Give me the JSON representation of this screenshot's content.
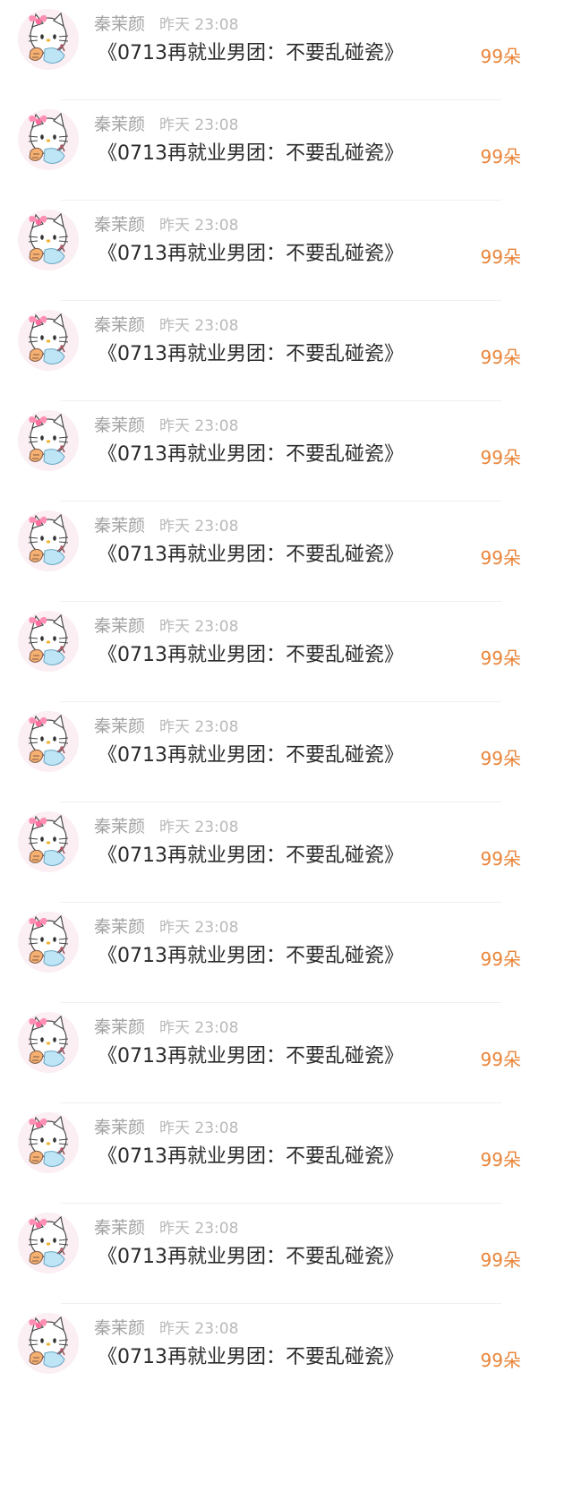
{
  "colors": {
    "name": "#a3a3a3",
    "time": "#b9b9b9",
    "message": "#2b2b2b",
    "count": "#ea8438",
    "avatar_bg": "#fbeff4"
  },
  "rows": [
    {
      "name": "秦茉颜",
      "time": "昨天 23:08",
      "message": "《0713再就业男团：不要乱碰瓷》",
      "count": "99朵",
      "avatar_icon": "hello-kitty-avatar-icon"
    },
    {
      "name": "秦茉颜",
      "time": "昨天 23:08",
      "message": "《0713再就业男团：不要乱碰瓷》",
      "count": "99朵",
      "avatar_icon": "hello-kitty-avatar-icon"
    },
    {
      "name": "秦茉颜",
      "time": "昨天 23:08",
      "message": "《0713再就业男团：不要乱碰瓷》",
      "count": "99朵",
      "avatar_icon": "hello-kitty-avatar-icon"
    },
    {
      "name": "秦茉颜",
      "time": "昨天 23:08",
      "message": "《0713再就业男团：不要乱碰瓷》",
      "count": "99朵",
      "avatar_icon": "hello-kitty-avatar-icon"
    },
    {
      "name": "秦茉颜",
      "time": "昨天 23:08",
      "message": "《0713再就业男团：不要乱碰瓷》",
      "count": "99朵",
      "avatar_icon": "hello-kitty-avatar-icon"
    },
    {
      "name": "秦茉颜",
      "time": "昨天 23:08",
      "message": "《0713再就业男团：不要乱碰瓷》",
      "count": "99朵",
      "avatar_icon": "hello-kitty-avatar-icon"
    },
    {
      "name": "秦茉颜",
      "time": "昨天 23:08",
      "message": "《0713再就业男团：不要乱碰瓷》",
      "count": "99朵",
      "avatar_icon": "hello-kitty-avatar-icon"
    },
    {
      "name": "秦茉颜",
      "time": "昨天 23:08",
      "message": "《0713再就业男团：不要乱碰瓷》",
      "count": "99朵",
      "avatar_icon": "hello-kitty-avatar-icon"
    },
    {
      "name": "秦茉颜",
      "time": "昨天 23:08",
      "message": "《0713再就业男团：不要乱碰瓷》",
      "count": "99朵",
      "avatar_icon": "hello-kitty-avatar-icon"
    },
    {
      "name": "秦茉颜",
      "time": "昨天 23:08",
      "message": "《0713再就业男团：不要乱碰瓷》",
      "count": "99朵",
      "avatar_icon": "hello-kitty-avatar-icon"
    },
    {
      "name": "秦茉颜",
      "time": "昨天 23:08",
      "message": "《0713再就业男团：不要乱碰瓷》",
      "count": "99朵",
      "avatar_icon": "hello-kitty-avatar-icon"
    },
    {
      "name": "秦茉颜",
      "time": "昨天 23:08",
      "message": "《0713再就业男团：不要乱碰瓷》",
      "count": "99朵",
      "avatar_icon": "hello-kitty-avatar-icon"
    },
    {
      "name": "秦茉颜",
      "time": "昨天 23:08",
      "message": "《0713再就业男团：不要乱碰瓷》",
      "count": "99朵",
      "avatar_icon": "hello-kitty-avatar-icon"
    },
    {
      "name": "秦茉颜",
      "time": "昨天 23:08",
      "message": "《0713再就业男团：不要乱碰瓷》",
      "count": "99朵",
      "avatar_icon": "hello-kitty-avatar-icon"
    }
  ]
}
